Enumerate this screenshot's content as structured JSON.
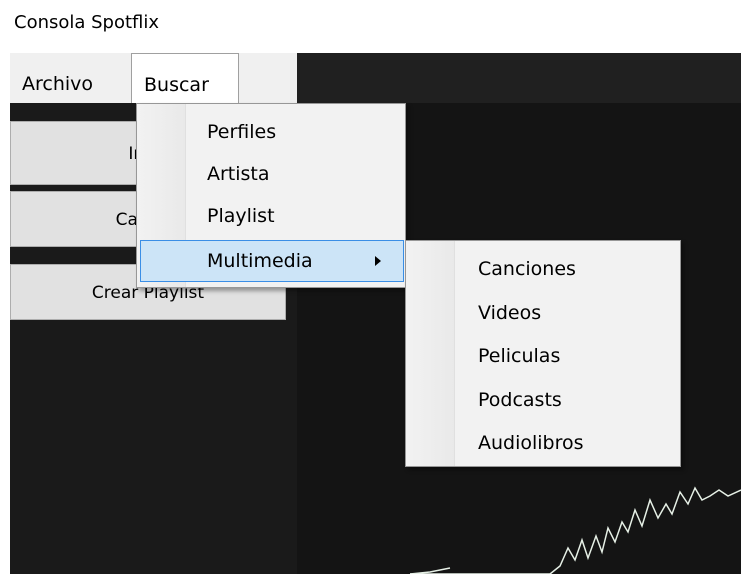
{
  "window": {
    "title": "Consola Spotflix"
  },
  "menubar": {
    "archivo": "Archivo",
    "buscar": "Buscar"
  },
  "buttons": {
    "b1": "Infor",
    "b2": "Cambio",
    "b3": "Crear Playlist"
  },
  "buscar_menu": {
    "items": [
      "Perfiles",
      "Artista",
      "Playlist"
    ],
    "multimedia": "Multimedia"
  },
  "multimedia_menu": {
    "items": [
      "Canciones",
      "Videos",
      "Peliculas",
      "Podcasts",
      "Audiolibros"
    ]
  },
  "colors": {
    "highlight": "#cce4f7",
    "highlight_border": "#3a8ee6",
    "background_dark": "#141414",
    "chart_line": "#e6f0e6"
  }
}
